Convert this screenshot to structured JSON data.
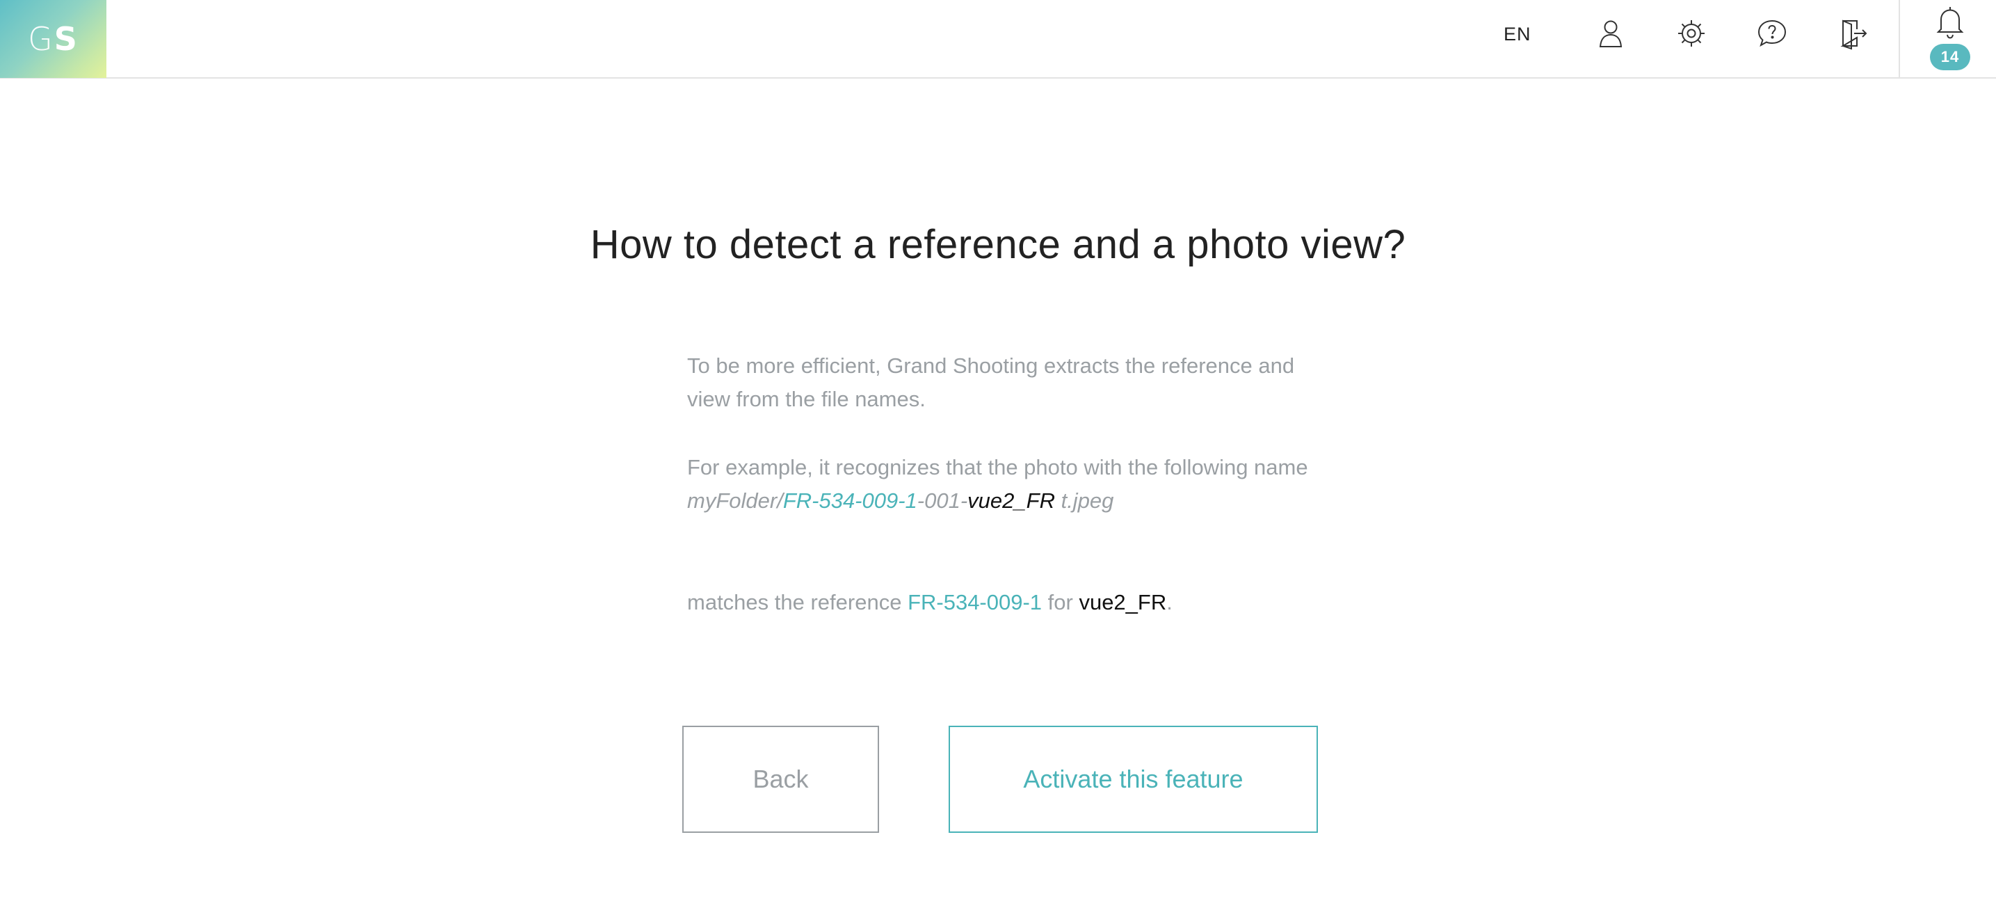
{
  "header": {
    "logo_g": "G",
    "logo_s": "S",
    "language": "EN",
    "icons": [
      "user-icon",
      "settings-icon",
      "help-icon",
      "logout-icon",
      "bell-icon"
    ],
    "notification_count": "14"
  },
  "main": {
    "title": "How to detect a reference and a photo view?",
    "paragraph1": "To be more efficient, Grand Shooting extracts the reference and view from the file names.",
    "paragraph2_intro": "For example, it recognizes that the photo with the following name",
    "example": {
      "folder": "myFolder/",
      "reference": "FR-534-009-1",
      "middle": "-001-",
      "view": "vue2_FR",
      "suffix": " t.jpeg"
    },
    "match": {
      "prefix": "matches the reference ",
      "reference": "FR-534-009-1",
      "for": " for ",
      "view": "vue2_FR",
      "end": "."
    },
    "back_label": "Back",
    "activate_label": "Activate this feature"
  },
  "colors": {
    "accent": "#4ab3b8",
    "badge": "#59b9bf",
    "muted_text": "#9a9fa3",
    "title_text": "#222222"
  }
}
